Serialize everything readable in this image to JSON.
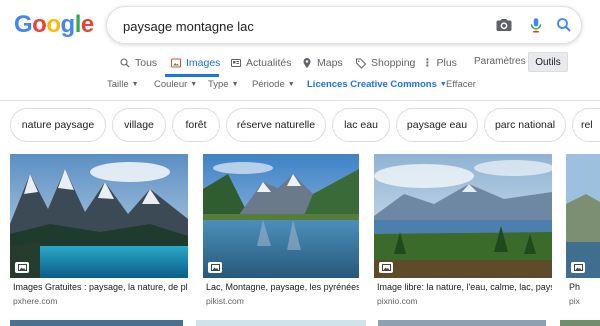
{
  "logo": [
    "G",
    "o",
    "o",
    "g",
    "l",
    "e"
  ],
  "search": {
    "query": "paysage montagne lac"
  },
  "tabs": [
    {
      "label": "Tous",
      "icon": "search-icon"
    },
    {
      "label": "Images",
      "icon": "image-icon"
    },
    {
      "label": "Actualités",
      "icon": "news-icon"
    },
    {
      "label": "Maps",
      "icon": "map-pin-icon"
    },
    {
      "label": "Shopping",
      "icon": "tag-icon"
    },
    {
      "label": "Plus",
      "icon": "more-vert-icon"
    }
  ],
  "settings_label": "Paramètres",
  "tools_label": "Outils",
  "filters": [
    {
      "label": "Taille"
    },
    {
      "label": "Couleur"
    },
    {
      "label": "Type"
    },
    {
      "label": "Période"
    },
    {
      "label": "Licences Creative Commons"
    }
  ],
  "clear_label": "Effacer",
  "chips": [
    "nature paysage",
    "village",
    "forêt",
    "réserve naturelle",
    "lac eau",
    "paysage eau",
    "parc national",
    "rel"
  ],
  "results": [
    {
      "caption": "Images Gratuites : paysage, la nature, de ple...",
      "source": "pxhere.com"
    },
    {
      "caption": "Lac, Montagne, paysage, les pyrénées,...",
      "source": "pikist.com"
    },
    {
      "caption": "Image libre: la nature, l'eau, calme, lac, pays...",
      "source": "pixnio.com"
    },
    {
      "caption": "Ph",
      "source": "pix"
    }
  ],
  "colors": {
    "accent": "#1a73e8",
    "text": "#202124",
    "muted": "#5f6368",
    "border": "#dadce0"
  }
}
